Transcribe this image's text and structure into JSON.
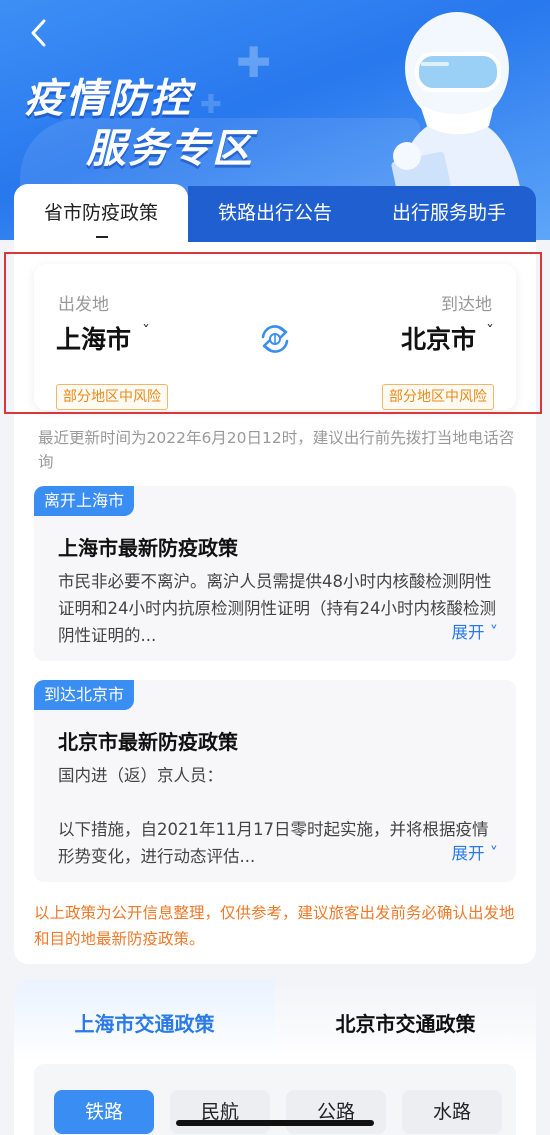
{
  "banner": {
    "title_line1": "疫情防控",
    "title_line2": "服务专区"
  },
  "tabs": [
    {
      "label": "省市防疫政策",
      "active": true
    },
    {
      "label": "铁路出行公告",
      "active": false
    },
    {
      "label": "出行服务助手",
      "active": false
    }
  ],
  "route": {
    "from_label": "出发地",
    "from_city": "上海市",
    "from_risk": "部分地区中风险",
    "to_label": "到达地",
    "to_city": "北京市",
    "to_risk": "部分地区中风险",
    "caret": "ˇ"
  },
  "update_note": "最近更新时间为2022年6月20日12时，建议出行前先拨打当地电话咨询",
  "policies": [
    {
      "tag": "离开上海市",
      "title": "上海市最新防疫政策",
      "text": "市民非必要不离沪。离沪人员需提供48小时内核酸检测阴性证明和24小时内抗原检测阴性证明（持有24小时内核酸检测阴性证明的...",
      "expand": "展开 ˅"
    },
    {
      "tag": "到达北京市",
      "title": "北京市最新防疫政策",
      "text_line1": "国内进（返）京人员：",
      "text_line2": "以下措施，自2021年11月17日零时起实施，并将根据疫情形势变化，进行动态评估...",
      "expand": "展开 ˅"
    }
  ],
  "disclaimer": "以上政策为公开信息整理，仅供参考，建议旅客出发前务必确认出发地和目的地最新防疫政策。",
  "traffic": {
    "tab_left": "上海市交通政策",
    "tab_right": "北京市交通政策",
    "modes": [
      "铁路",
      "民航",
      "公路",
      "水路"
    ]
  },
  "colors": {
    "accent": "#2a7ae8",
    "tab_dark": "#1f5fd0",
    "risk": "#e98a1a",
    "disclaimer": "#f07a2a",
    "highlight": "#d9363e"
  }
}
